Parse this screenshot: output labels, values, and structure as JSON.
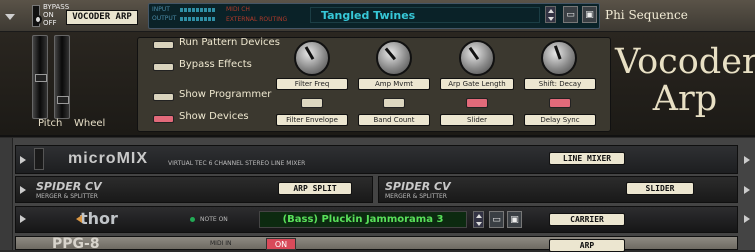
{
  "header": {
    "bypass_labels": [
      "BYPASS",
      "ON",
      "OFF"
    ],
    "device_name": "VOCODER ARP",
    "meter_labels": [
      "INPUT",
      "OUTPUT"
    ],
    "midi_label": "MIDI CH",
    "external_routing_label": "EXTERNAL ROUTING",
    "patch_name": "Tangled Twines",
    "patch_title": "Phi Sequence",
    "browse_icon": "folder-icon",
    "save_icon": "save-icon"
  },
  "main": {
    "title_line1": "Vocoder",
    "title_line2": "Arp",
    "pitch_label": "Pitch",
    "wheel_label": "Wheel",
    "buttons": [
      {
        "label": "Run Pattern Devices",
        "state": "off"
      },
      {
        "label": "Bypass Effects",
        "state": "off"
      },
      {
        "label": "Show Programmer",
        "state": "off"
      },
      {
        "label": "Show Devices",
        "state": "on"
      }
    ],
    "knobs": [
      {
        "label": "Filter Freq"
      },
      {
        "label": "Amp Mvmt"
      },
      {
        "label": "Arp Gate Length"
      },
      {
        "label": "Shift: Decay"
      }
    ],
    "small_buttons": [
      {
        "label": "Filter Envelope",
        "state": "off"
      },
      {
        "label": "Band Count",
        "state": "off"
      },
      {
        "label": "Slider",
        "state": "on"
      },
      {
        "label": "Delay Sync",
        "state": "on"
      }
    ]
  },
  "rack": {
    "micromix": {
      "brand": "microMIX",
      "subtitle": "VIRTUAL TEC 6 CHANNEL STEREO LINE MIXER",
      "label": "LINE MIXER"
    },
    "spider_left": {
      "title": "SPIDER CV",
      "subtitle": "MERGER & SPLITTER",
      "label": "ARP SPLIT"
    },
    "spider_right": {
      "title": "SPIDER CV",
      "subtitle": "MERGER & SPLITTER",
      "label": "SLIDER"
    },
    "thor": {
      "brand": "thor",
      "note_on": "NOTE ON",
      "patch": "(Bass) Pluckin Jammorama 3",
      "label": "CARRIER"
    },
    "ppg": {
      "brand": "PPG-8",
      "midi": "MIDI IN",
      "button": "ON",
      "label": "ARP"
    }
  },
  "colors": {
    "accent_red": "#e26a7a",
    "lcd_cyan": "#37c8d8",
    "lcd_green": "#59e05a",
    "panel_cream": "#ece6d0"
  }
}
